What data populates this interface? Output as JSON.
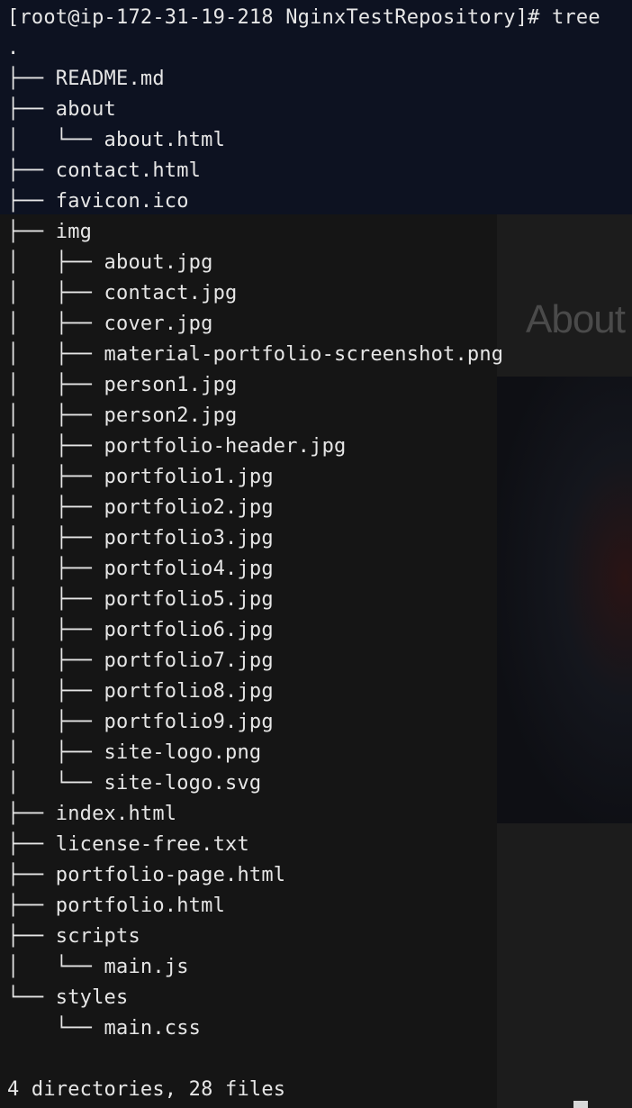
{
  "prompt": "[root@ip-172-31-19-218 NginxTestRepository]# tree",
  "background": {
    "page_heading": "About"
  },
  "tree_lines": [
    ".",
    "├── README.md",
    "├── about",
    "│   └── about.html",
    "├── contact.html",
    "├── favicon.ico",
    "├── img",
    "│   ├── about.jpg",
    "│   ├── contact.jpg",
    "│   ├── cover.jpg",
    "│   ├── material-portfolio-screenshot.png",
    "│   ├── person1.jpg",
    "│   ├── person2.jpg",
    "│   ├── portfolio-header.jpg",
    "│   ├── portfolio1.jpg",
    "│   ├── portfolio2.jpg",
    "│   ├── portfolio3.jpg",
    "│   ├── portfolio4.jpg",
    "│   ├── portfolio5.jpg",
    "│   ├── portfolio6.jpg",
    "│   ├── portfolio7.jpg",
    "│   ├── portfolio8.jpg",
    "│   ├── portfolio9.jpg",
    "│   ├── site-logo.png",
    "│   └── site-logo.svg",
    "├── index.html",
    "├── license-free.txt",
    "├── portfolio-page.html",
    "├── portfolio.html",
    "├── scripts",
    "│   └── main.js",
    "└── styles",
    "    └── main.css"
  ],
  "summary": "4 directories, 28 files",
  "colors": {
    "text": "#e6e6e6",
    "terminal_bg_top": "#0d1221",
    "terminal_bg": "#151515"
  }
}
